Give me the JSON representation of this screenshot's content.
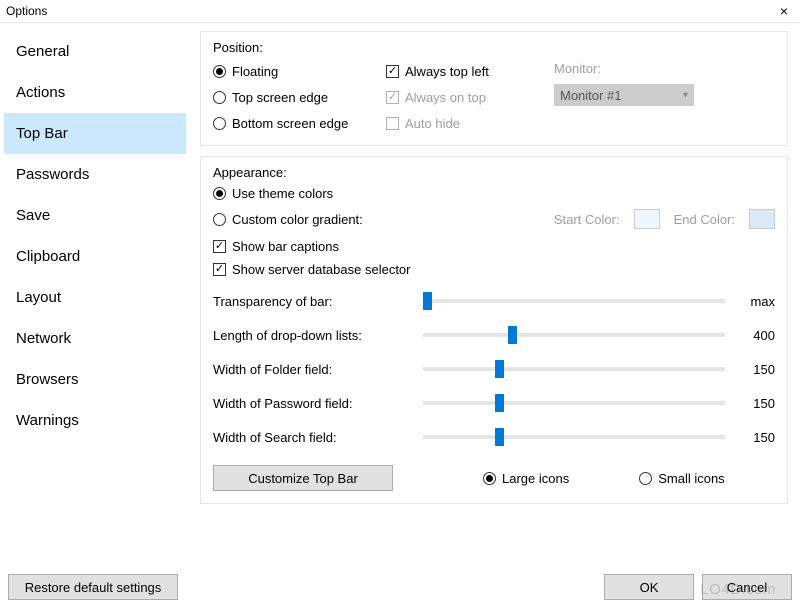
{
  "window": {
    "title": "Options",
    "close": "×"
  },
  "sidebar": {
    "items": [
      {
        "label": "General"
      },
      {
        "label": "Actions"
      },
      {
        "label": "Top Bar"
      },
      {
        "label": "Passwords"
      },
      {
        "label": "Save"
      },
      {
        "label": "Clipboard"
      },
      {
        "label": "Layout"
      },
      {
        "label": "Network"
      },
      {
        "label": "Browsers"
      },
      {
        "label": "Warnings"
      }
    ],
    "selected_index": 2
  },
  "position": {
    "title": "Position:",
    "floating": "Floating",
    "top_edge": "Top screen edge",
    "bottom_edge": "Bottom screen edge",
    "always_top_left": "Always top left",
    "always_on_top": "Always on top",
    "auto_hide": "Auto hide",
    "monitor_label": "Monitor:",
    "monitor_value": "Monitor #1"
  },
  "appearance": {
    "title": "Appearance:",
    "use_theme": "Use theme colors",
    "custom_gradient": "Custom color gradient:",
    "start_color_label": "Start Color:",
    "end_color_label": "End Color:",
    "show_captions": "Show bar captions",
    "show_selector": "Show server database selector",
    "sliders": [
      {
        "label": "Transparency of bar:",
        "value": "max",
        "pos": 0
      },
      {
        "label": "Length of drop-down lists:",
        "value": "400",
        "pos": 28
      },
      {
        "label": "Width of Folder field:",
        "value": "150",
        "pos": 24
      },
      {
        "label": "Width of Password field:",
        "value": "150",
        "pos": 24
      },
      {
        "label": "Width of Search field:",
        "value": "150",
        "pos": 24
      }
    ],
    "customize_btn": "Customize Top Bar",
    "large_icons": "Large icons",
    "small_icons": "Small icons"
  },
  "footer": {
    "restore": "Restore default settings",
    "ok": "OK",
    "cancel": "Cancel"
  },
  "watermark": "LO4D.com"
}
